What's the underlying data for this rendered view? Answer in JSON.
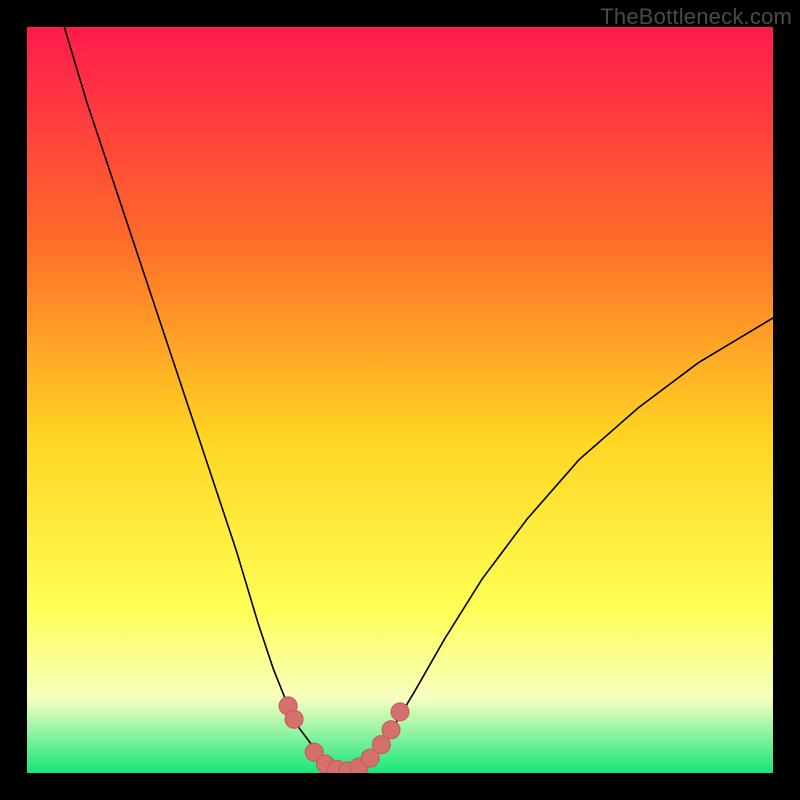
{
  "attribution": "TheBottleneck.com",
  "colors": {
    "frame": "#000000",
    "grad_top": "#ff1a4d",
    "grad_mid_upper": "#ff6a2a",
    "grad_mid": "#ffd522",
    "grad_mid_lower": "#ffff55",
    "grad_low": "#f7ffc0",
    "grad_bottom": "#17e67a",
    "curve": "#000000",
    "marker_fill": "#d6706c",
    "marker_stroke": "#c65b57"
  },
  "chart_data": {
    "type": "line",
    "title": "",
    "xlabel": "",
    "ylabel": "",
    "xlim": [
      0,
      100
    ],
    "ylim": [
      0,
      100
    ],
    "grid": false,
    "legend": false,
    "annotations": [],
    "series": [
      {
        "name": "left-curve",
        "x": [
          5,
          8,
          12,
          16,
          20,
          24,
          28,
          31,
          33,
          35,
          36.5,
          38,
          39.5,
          41,
          42,
          43
        ],
        "y": [
          100,
          90,
          78,
          66,
          54,
          42,
          30,
          20,
          14,
          9,
          6,
          4,
          2.5,
          1.2,
          0.5,
          0
        ]
      },
      {
        "name": "right-curve",
        "x": [
          43,
          44,
          45.5,
          47,
          49,
          52,
          56,
          61,
          67,
          74,
          82,
          90,
          100
        ],
        "y": [
          0,
          0.5,
          1.5,
          3,
          6,
          11,
          18,
          26,
          34,
          42,
          49,
          55,
          61
        ]
      }
    ],
    "markers": [
      {
        "x": 35.0,
        "y": 9.0
      },
      {
        "x": 35.8,
        "y": 7.2
      },
      {
        "x": 38.5,
        "y": 2.8
      },
      {
        "x": 40.0,
        "y": 1.2
      },
      {
        "x": 41.5,
        "y": 0.5
      },
      {
        "x": 43.0,
        "y": 0.3
      },
      {
        "x": 44.5,
        "y": 0.8
      },
      {
        "x": 46.0,
        "y": 2.0
      },
      {
        "x": 47.5,
        "y": 3.8
      },
      {
        "x": 48.8,
        "y": 5.8
      },
      {
        "x": 50.0,
        "y": 8.2
      }
    ],
    "marker_radius": 1.2
  }
}
